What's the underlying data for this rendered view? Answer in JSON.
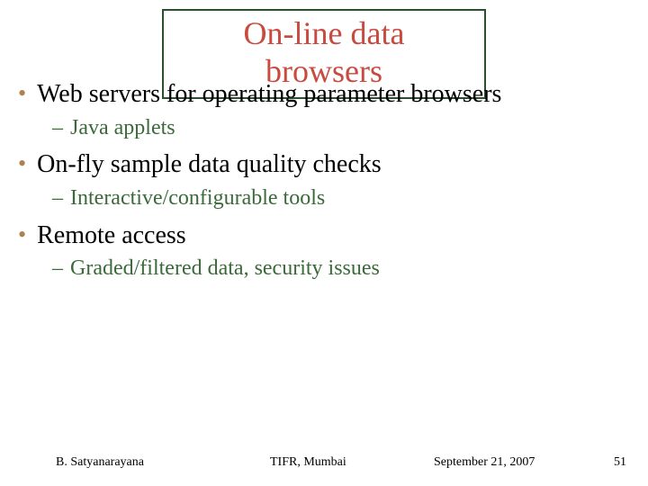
{
  "title": "On-line data browsers",
  "bullets": [
    {
      "text": "Web servers for operating parameter browsers",
      "sub": "Java applets"
    },
    {
      "text": "On-fly sample data quality checks",
      "sub": "Interactive/configurable tools"
    },
    {
      "text": "Remote access",
      "sub": "Graded/filtered data, security issues"
    }
  ],
  "footer": {
    "author": "B. Satyanarayana",
    "org": "TIFR, Mumbai",
    "date": "September 21, 2007",
    "page": "51"
  }
}
